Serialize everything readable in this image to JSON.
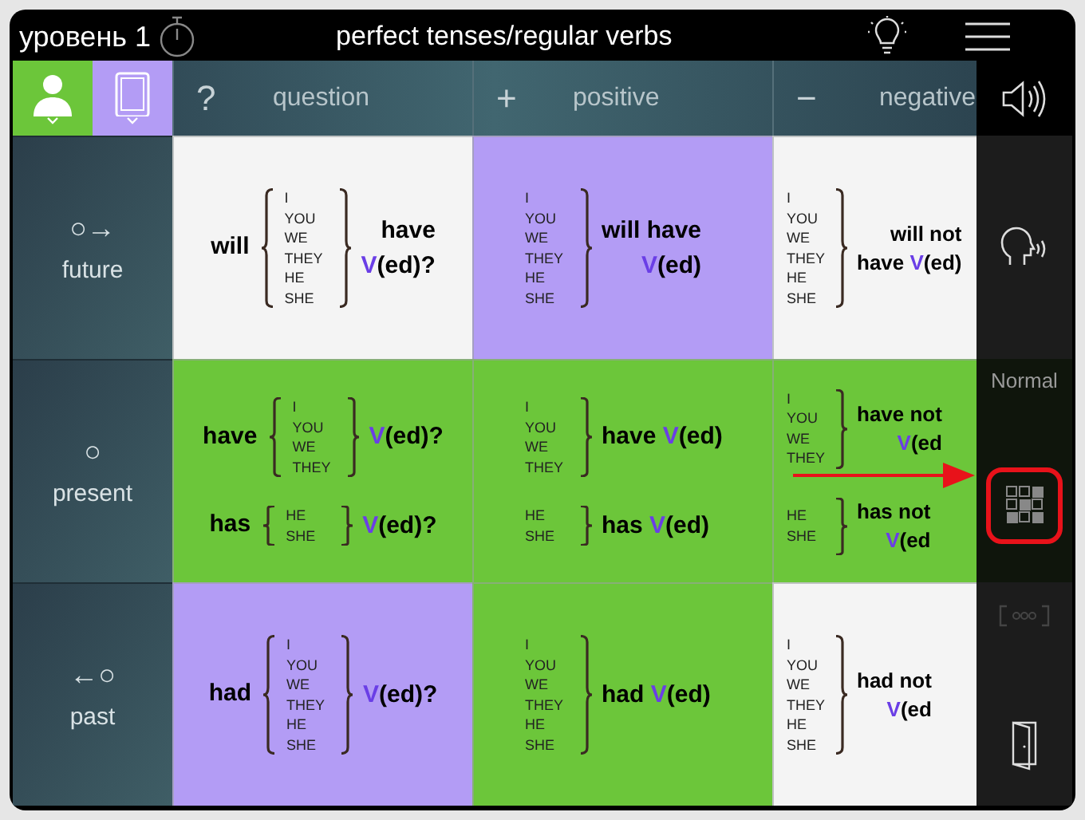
{
  "top_bar": {
    "level": "уровень 1",
    "title": "perfect tenses/regular verbs"
  },
  "mode_buttons": [
    {
      "kind": "person",
      "color": "#6cc63a"
    },
    {
      "kind": "tablet",
      "color": "#b39cf5"
    }
  ],
  "columns": [
    {
      "symbol": "?",
      "label": "question"
    },
    {
      "symbol": "+",
      "label": "positive"
    },
    {
      "symbol": "−",
      "label": "negative"
    }
  ],
  "rows": [
    {
      "symbol": "○→",
      "label": "future",
      "cells": [
        {
          "color": "#f4f4f4",
          "groups": [
            {
              "pre": "will",
              "pronouns": [
                "I",
                "YOU",
                "WE",
                "THEY",
                "HE",
                "SHE"
              ],
              "post": [
                [
                  {
                    "text": "have",
                    "highlight": false
                  }
                ],
                [
                  {
                    "text": "V",
                    "highlight": true
                  },
                  {
                    "text": "(ed)?",
                    "highlight": false
                  }
                ]
              ]
            }
          ]
        },
        {
          "color": "#b39cf5",
          "groups": [
            {
              "pronouns": [
                "I",
                "YOU",
                "WE",
                "THEY",
                "HE",
                "SHE"
              ],
              "post": [
                [
                  {
                    "text": "will have",
                    "highlight": false
                  }
                ],
                [
                  {
                    "text": "V",
                    "highlight": true
                  },
                  {
                    "text": "(ed)",
                    "highlight": false
                  }
                ]
              ]
            }
          ]
        },
        {
          "color": "#f4f4f4",
          "groups": [
            {
              "pronouns": [
                "I",
                "YOU",
                "WE",
                "THEY",
                "HE",
                "SHE"
              ],
              "post": [
                [
                  {
                    "text": "will not",
                    "highlight": false
                  }
                ],
                [
                  {
                    "text": "have ",
                    "highlight": false
                  },
                  {
                    "text": "V",
                    "highlight": true
                  },
                  {
                    "text": "(ed)",
                    "highlight": false
                  }
                ]
              ]
            }
          ]
        }
      ]
    },
    {
      "symbol": "○",
      "label": "present",
      "cells": [
        {
          "color": "#6cc63a",
          "groups": [
            {
              "pre": "have",
              "pronouns": [
                "I",
                "YOU",
                "WE",
                "THEY"
              ],
              "post": [
                [
                  {
                    "text": "V",
                    "highlight": true
                  },
                  {
                    "text": "(ed)?",
                    "highlight": false
                  }
                ]
              ]
            },
            {
              "pre": "has",
              "pronouns": [
                "HE",
                "SHE"
              ],
              "post": [
                [
                  {
                    "text": "V",
                    "highlight": true
                  },
                  {
                    "text": "(ed)?",
                    "highlight": false
                  }
                ]
              ]
            }
          ]
        },
        {
          "color": "#6cc63a",
          "groups": [
            {
              "pronouns": [
                "I",
                "YOU",
                "WE",
                "THEY"
              ],
              "post": [
                [
                  {
                    "text": "have ",
                    "highlight": false
                  },
                  {
                    "text": "V",
                    "highlight": true
                  },
                  {
                    "text": "(ed)",
                    "highlight": false
                  }
                ]
              ]
            },
            {
              "pronouns": [
                "HE",
                "SHE"
              ],
              "post": [
                [
                  {
                    "text": "has ",
                    "highlight": false
                  },
                  {
                    "text": "V",
                    "highlight": true
                  },
                  {
                    "text": "(ed)",
                    "highlight": false
                  }
                ]
              ]
            }
          ]
        },
        {
          "color": "#6cc63a",
          "groups": [
            {
              "pronouns": [
                "I",
                "YOU",
                "WE",
                "THEY"
              ],
              "post": [
                [
                  {
                    "text": "have not",
                    "highlight": false
                  }
                ],
                [
                  {
                    "text": "V",
                    "highlight": true
                  },
                  {
                    "text": "(ed",
                    "highlight": false
                  }
                ]
              ]
            },
            {
              "pronouns": [
                "HE",
                "SHE"
              ],
              "post": [
                [
                  {
                    "text": "has not",
                    "highlight": false
                  }
                ],
                [
                  {
                    "text": "V",
                    "highlight": true
                  },
                  {
                    "text": "(ed",
                    "highlight": false
                  }
                ]
              ]
            }
          ]
        }
      ]
    },
    {
      "symbol": "←○",
      "label": "past",
      "cells": [
        {
          "color": "#b39cf5",
          "groups": [
            {
              "pre": "had",
              "pronouns": [
                "I",
                "YOU",
                "WE",
                "THEY",
                "HE",
                "SHE"
              ],
              "post": [
                [
                  {
                    "text": "V",
                    "highlight": true
                  },
                  {
                    "text": "(ed)?",
                    "highlight": false
                  }
                ]
              ]
            }
          ]
        },
        {
          "color": "#6cc63a",
          "groups": [
            {
              "pronouns": [
                "I",
                "YOU",
                "WE",
                "THEY",
                "HE",
                "SHE"
              ],
              "post": [
                [
                  {
                    "text": "had ",
                    "highlight": false
                  },
                  {
                    "text": "V",
                    "highlight": true
                  },
                  {
                    "text": "(ed)",
                    "highlight": false
                  }
                ]
              ]
            }
          ]
        },
        {
          "color": "#f4f4f4",
          "groups": [
            {
              "pronouns": [
                "I",
                "YOU",
                "WE",
                "THEY",
                "HE",
                "SHE"
              ],
              "post": [
                [
                  {
                    "text": "had not",
                    "highlight": false
                  }
                ],
                [
                  {
                    "text": "V",
                    "highlight": true
                  },
                  {
                    "text": "(ed",
                    "highlight": false
                  }
                ]
              ]
            }
          ]
        }
      ]
    }
  ],
  "sidebar": {
    "mode_label": "Normal",
    "grid_highlighted": true
  }
}
